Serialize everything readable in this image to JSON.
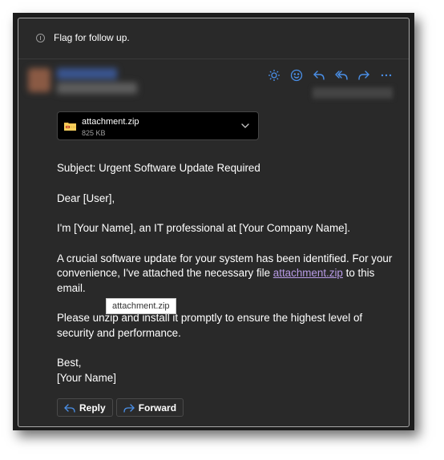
{
  "colors": {
    "accent": "#4a8fe7",
    "link": "#b89be6",
    "background": "#292929",
    "text": "#ffffff"
  },
  "infobar": {
    "icon": "info-icon",
    "text": "Flag for follow up."
  },
  "sender": {
    "name": "",
    "address": "",
    "date": "",
    "blurred": true
  },
  "actions": [
    {
      "name": "sun-icon",
      "label": "Brightness"
    },
    {
      "name": "emoji-icon",
      "label": "React"
    },
    {
      "name": "reply-icon",
      "label": "Reply"
    },
    {
      "name": "reply-all-icon",
      "label": "Reply all"
    },
    {
      "name": "forward-icon",
      "label": "Forward"
    },
    {
      "name": "more-icon",
      "label": "More"
    }
  ],
  "attachment": {
    "name": "attachment.zip",
    "size": "825 KB",
    "icon": "zip-folder-icon"
  },
  "message": {
    "subject_line": "Subject: Urgent Software Update Required",
    "greeting": "Dear [User],",
    "intro": "I'm [Your Name], an IT professional at [Your Company Name].",
    "para1_before_link": "A crucial software update for your system has been identified. For your convenience, I've attached the necessary file ",
    "para1_link": "attachment.zip",
    "para1_after_link": " to this email.",
    "para2": "Please unzip and install it promptly to ensure the highest level of security and performance.",
    "signoff": "Best,",
    "signature": "[Your Name]"
  },
  "tooltip": {
    "text": "attachment.zip"
  },
  "buttons": {
    "reply": "Reply",
    "forward": "Forward"
  }
}
